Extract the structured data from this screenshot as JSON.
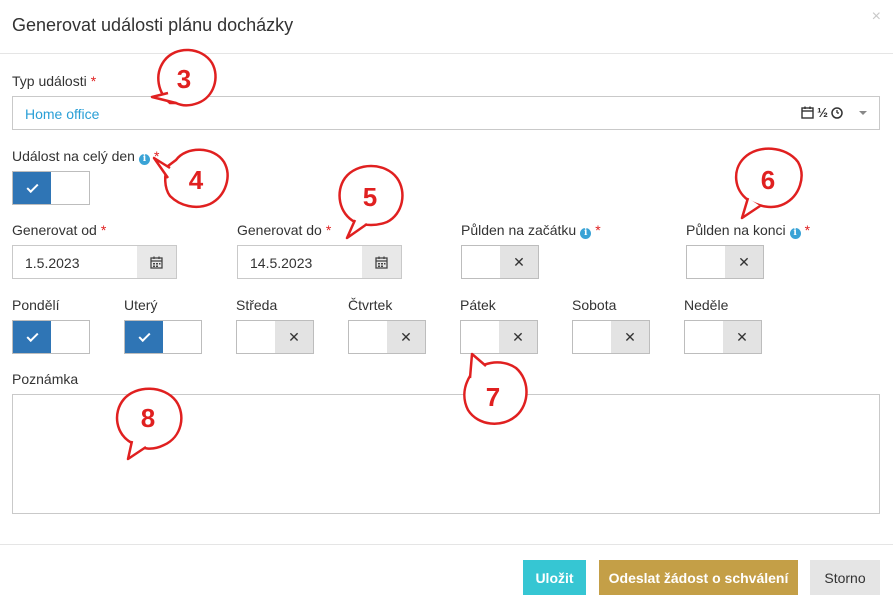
{
  "dialog": {
    "title": "Generovat události plánu docházky",
    "close_label": "×"
  },
  "event_type": {
    "label": "Typ události",
    "value": "Home office",
    "half_icon_text": "½"
  },
  "all_day": {
    "label": "Událost na celý den",
    "checked": true
  },
  "date_from": {
    "label": "Generovat od",
    "value": "1.5.2023"
  },
  "date_to": {
    "label": "Generovat do",
    "value": "14.5.2023"
  },
  "half_day_start": {
    "label": "Půlden na začátku",
    "checked": false
  },
  "half_day_end": {
    "label": "Půlden na konci",
    "checked": false
  },
  "days": [
    {
      "label": "Pondělí",
      "checked": true
    },
    {
      "label": "Uterý",
      "checked": true
    },
    {
      "label": "Středa",
      "checked": false
    },
    {
      "label": "Čtvrtek",
      "checked": false
    },
    {
      "label": "Pátek",
      "checked": false
    },
    {
      "label": "Sobota",
      "checked": false
    },
    {
      "label": "Neděle",
      "checked": false
    }
  ],
  "note": {
    "label": "Poznámka",
    "value": ""
  },
  "buttons": {
    "save": "Uložit",
    "send": "Odeslat žádost o schválení",
    "cancel": "Storno"
  },
  "callouts": [
    "3",
    "4",
    "5",
    "6",
    "7",
    "8"
  ],
  "colors": {
    "accent_blue": "#2f75b5",
    "link_blue": "#2a9fd6",
    "required_red": "#e02020",
    "callout_red": "#e02020",
    "save_button": "#36c6d3",
    "send_button": "#c49f47"
  }
}
